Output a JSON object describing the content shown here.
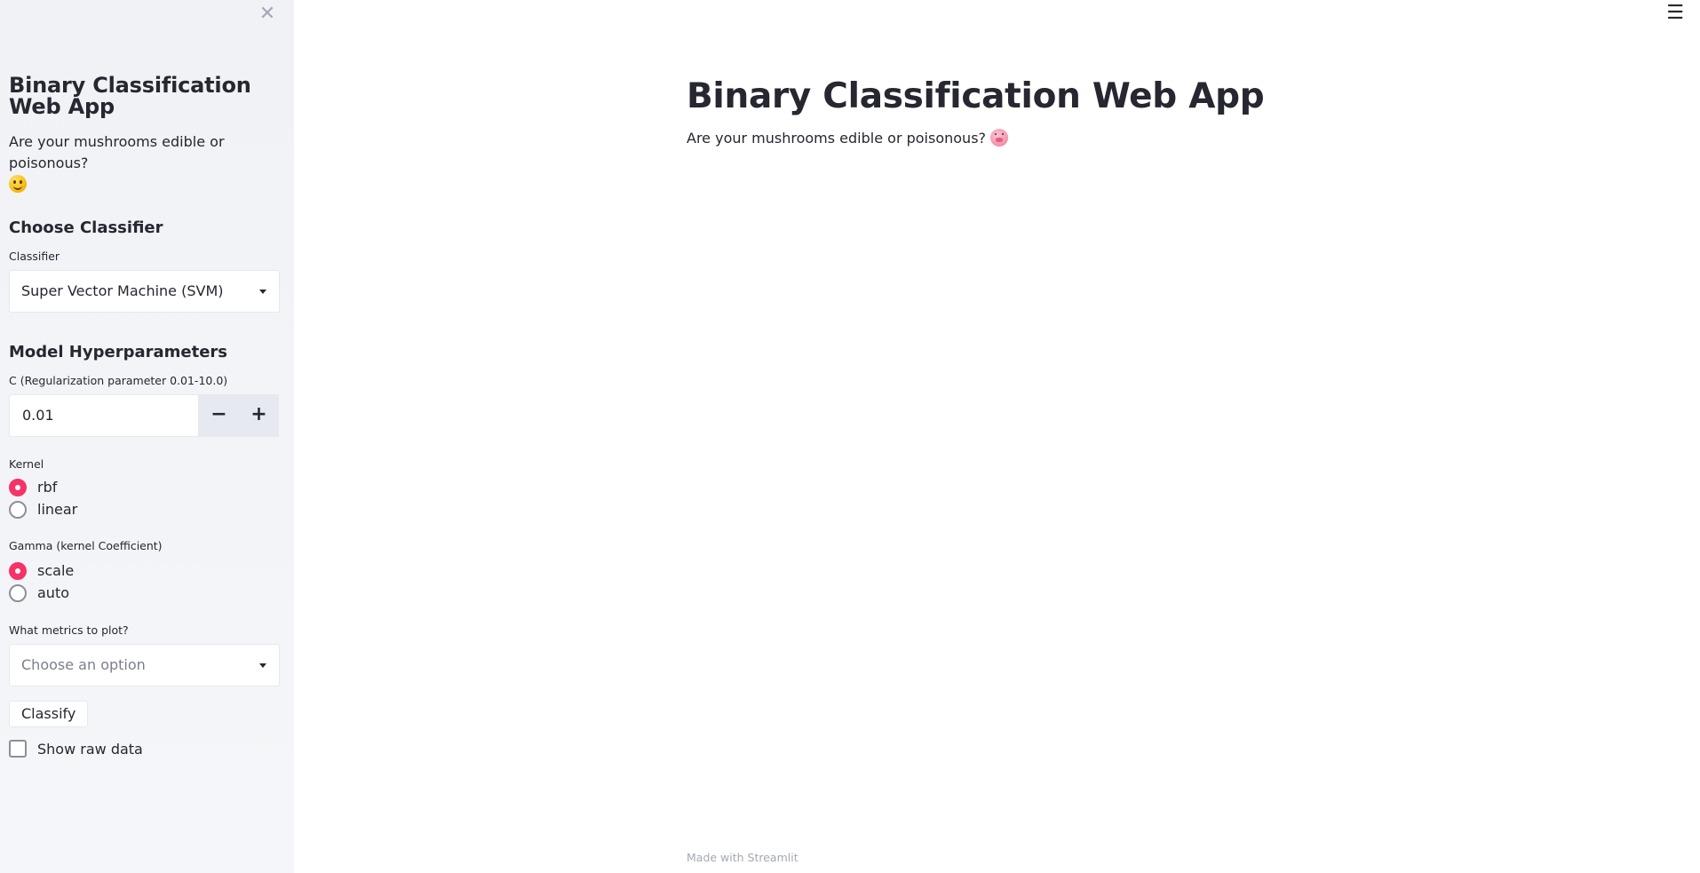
{
  "sidebar": {
    "close_icon": "close-icon",
    "title": "Binary Classification Web App",
    "subtitle": "Are your mushrooms edible or poisonous?",
    "subtitle_emoji": "grinning-face",
    "choose_classifier_heading": "Choose Classifier",
    "classifier_label": "Classifier",
    "classifier_value": "Super Vector Machine (SVM)",
    "hyperparams_heading": "Model Hyperparameters",
    "c_label": "C (Regularization parameter 0.01-10.0)",
    "c_value": "0.01",
    "minus_label": "−",
    "plus_label": "+",
    "kernel_label": "Kernel",
    "kernel_options": [
      "rbf",
      "linear"
    ],
    "kernel_selected": "rbf",
    "gamma_label": "Gamma (kernel Coefficient)",
    "gamma_options": [
      "scale",
      "auto"
    ],
    "gamma_selected": "scale",
    "metrics_label": "What metrics to plot?",
    "metrics_placeholder": "Choose an option",
    "classify_label": "Classify",
    "show_raw_label": "Show raw data"
  },
  "main": {
    "menu_icon": "hamburger-menu-icon",
    "title": "Binary Classification Web App",
    "subtitle": "Are your mushrooms edible or poisonous?",
    "subtitle_emoji": "pig-face",
    "footer": "Made with Streamlit"
  },
  "colors": {
    "accent": "#f63366",
    "sidebar_bg": "#f0f2f6",
    "text": "#262730",
    "muted": "#a3a8b4"
  }
}
